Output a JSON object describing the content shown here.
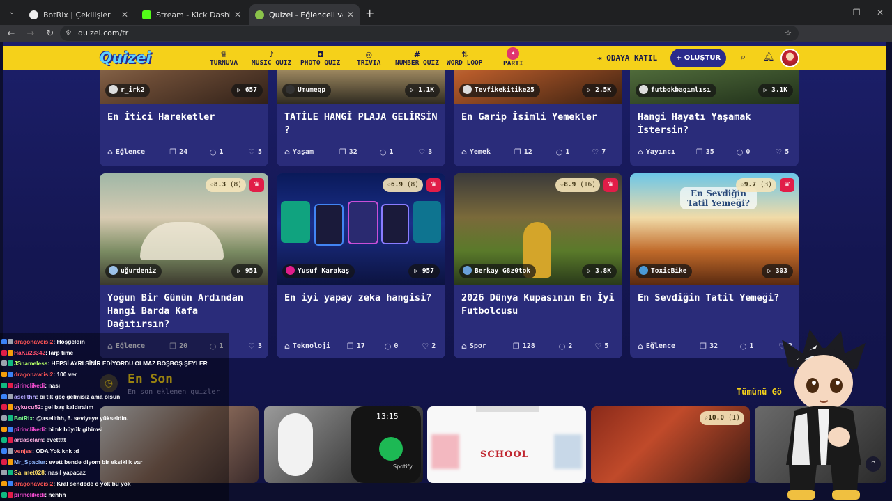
{
  "browser": {
    "tabs": [
      {
        "title": "BotRix | Çekilişler",
        "color": "#1f2022"
      },
      {
        "title": "Stream - Kick Dashboard",
        "color": "#53fc18"
      },
      {
        "title": "Quizei - Eğlenceli ve etkileşimli",
        "color": "#6b8e23",
        "active": true
      }
    ],
    "url": "quizei.com/tr"
  },
  "site": {
    "logo": "Quizei",
    "nav": [
      {
        "label": "TURNUVA",
        "icon": "trophy-icon"
      },
      {
        "label": "MUSIC QUIZ",
        "icon": "music-note-icon"
      },
      {
        "label": "PHOTO QUIZ",
        "icon": "camera-icon"
      },
      {
        "label": "TRIVIA",
        "icon": "speech-bubble-icon"
      },
      {
        "label": "NUMBER QUIZ",
        "icon": "hash-icon"
      },
      {
        "label": "WORD LOOP",
        "icon": "sort-icon"
      },
      {
        "label": "PARTI",
        "icon": "party-icon"
      }
    ],
    "join_label": "ODAYA KATIL",
    "create_label": "OLUŞTUR"
  },
  "row1": [
    {
      "user": "r_irk2",
      "views": "657",
      "title": "En İtici Hareketler",
      "category": "Eğlence",
      "questions": "24",
      "comments": "1",
      "likes": "5"
    },
    {
      "user": "Umumeqp",
      "views": "1.1K",
      "title": "TATİLE HANGİ PLAJA GELİRSİN ?",
      "category": "Yaşam",
      "questions": "32",
      "comments": "1",
      "likes": "3"
    },
    {
      "user": "Tevfikekitike25",
      "views": "2.5K",
      "title": "En Garip İsimli Yemekler",
      "category": "Yemek",
      "questions": "12",
      "comments": "1",
      "likes": "7"
    },
    {
      "user": "futbokbagımlısı",
      "views": "3.1K",
      "title": "Hangi Hayatı Yaşamak İstersin?",
      "category": "Yayıncı",
      "questions": "35",
      "comments": "0",
      "likes": "5"
    }
  ],
  "row2": [
    {
      "rating": "8.3",
      "rating_count": "(8)",
      "user": "uğurdeniz",
      "views": "951",
      "title": "Yoğun Bir Günün Ardından Hangi Barda Kafa Dağıtırsın?",
      "category": "Eğlence",
      "questions": "20",
      "comments": "1",
      "likes": "3"
    },
    {
      "rating": "6.9",
      "rating_count": "(8)",
      "user": "Yusuf Karakaş",
      "views": "957",
      "title": "En iyi yapay zeka hangisi?",
      "category": "Teknoloji",
      "questions": "17",
      "comments": "0",
      "likes": "2"
    },
    {
      "rating": "8.9",
      "rating_count": "(16)",
      "user": "Berkay G8z0tok",
      "views": "3.8K",
      "title": "2026 Dünya Kupasının En İyi Futbolcusu",
      "category": "Spor",
      "questions": "128",
      "comments": "2",
      "likes": "5"
    },
    {
      "rating": "9.7",
      "rating_count": "(3)",
      "user": "ToxicBike",
      "views": "303",
      "title": "En Sevdiğin Tatil Yemeği?",
      "category": "Eğlence",
      "questions": "32",
      "comments": "1",
      "likes": "2",
      "image_text": "En Sevdiğin Tatil Yemeği?"
    }
  ],
  "latest": {
    "title": "En Son",
    "subtitle": "En son eklenen quizler",
    "see_all": "Tümünü Gö",
    "thumb_texts": [
      "13:15",
      "Spotify",
      "SCHOOL"
    ],
    "rating": "10.0",
    "rating_count": "(1)"
  },
  "chat": [
    {
      "user": "dragonavcisi2",
      "text": ": Hoşgeldin",
      "color": "#ff5555"
    },
    {
      "user": "HaKu23342",
      "text": ": larp time",
      "color": "#ff4f6b"
    },
    {
      "user": "JSnameless",
      "text": ": HEPSİ AYRI SİNİR EDİYORDU OLMAZ BOŞBOŞ ŞEYLER",
      "color": "#b4ff66"
    },
    {
      "user": "dragonavcisi2",
      "text": ": 100 ver",
      "color": "#ff5555"
    },
    {
      "user": "pirinclikedi",
      "text": ": nası",
      "color": "#ff4fd8"
    },
    {
      "user": "aselithh",
      "text": ": bi tık geç gelmisiz ama olsun",
      "color": "#b4a8ff"
    },
    {
      "user": "uykucu52",
      "text": ": gel baş kaldıralım",
      "color": "#ff9ad8"
    },
    {
      "user": "BotRix",
      "text": ": @aselithh, 6. seviyeye yükseldin.",
      "color": "#7cff8a"
    },
    {
      "user": "pirinclikedi",
      "text": ": bi tık büyük gibimsi",
      "color": "#ff4fd8"
    },
    {
      "user": "ardaselam",
      "text": ": evettttt",
      "color": "#ffb0e0"
    },
    {
      "user": "venjss",
      "text": ": ODA Yok knk :d",
      "color": "#ff6666"
    },
    {
      "user": "Mr_Spacier",
      "text": ": evett bende diyom bir eksiklik var",
      "color": "#8fb8ff"
    },
    {
      "user": "Sa_met028",
      "text": ": nasıl yapacaz",
      "color": "#ffe066"
    },
    {
      "user": "dragonavcisi2",
      "text": ": Kral sendede o yok bu yok",
      "color": "#ff5555"
    },
    {
      "user": "pirinclikedi",
      "text": ": hehhh",
      "color": "#ff4fd8"
    }
  ]
}
